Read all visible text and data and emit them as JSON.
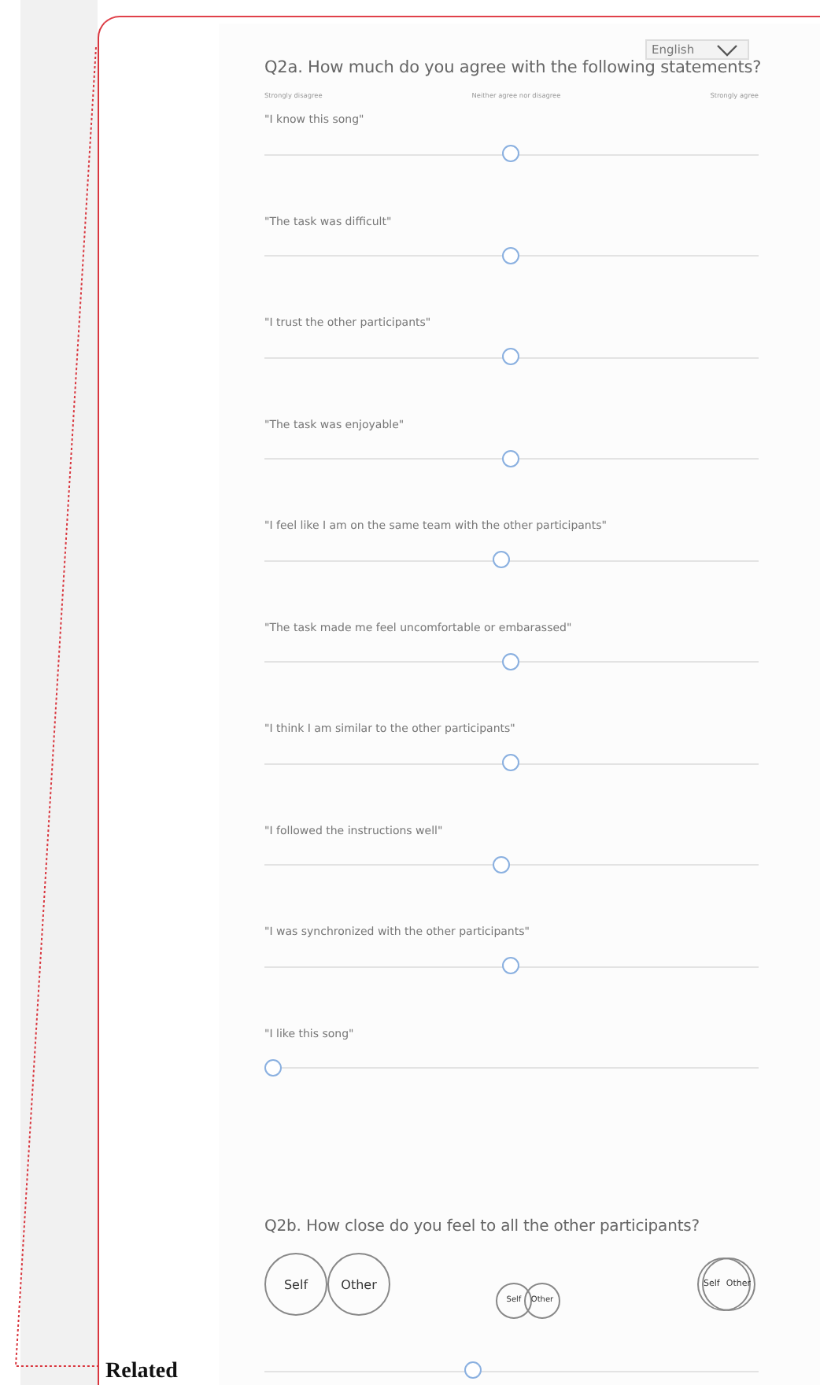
{
  "language_select": {
    "value": "English"
  },
  "q2a": {
    "title": "Q2a. How much do you agree with the following statements?",
    "scale_labels": [
      "Strongly disagree",
      "Neither agree nor disagree",
      "Strongly agree"
    ],
    "items": [
      {
        "statement": "\"I know this song\"",
        "level": 0.5
      },
      {
        "statement": "\"The task was difficult\"",
        "level": 0.5
      },
      {
        "statement": "\"I trust the other participants\"",
        "level": 0.5
      },
      {
        "statement": "\"The task was enjoyable\"",
        "level": 0.5
      },
      {
        "statement": "\"I feel like I am on the same team with the other participants\"",
        "level": 0.48
      },
      {
        "statement": "\"The task made me feel uncomfortable or embarassed\"",
        "level": 0.5
      },
      {
        "statement": "\"I think I am similar to the other participants\"",
        "level": 0.5
      },
      {
        "statement": "\"I followed the instructions well\"",
        "level": 0.48
      },
      {
        "statement": "\"I was synchronized with the other participants\"",
        "level": 0.5
      },
      {
        "statement": "\"I like this song\"",
        "level": 0
      }
    ]
  },
  "q2b": {
    "title": "Q2b. How close do you feel to all the other participants?",
    "options": [
      {
        "kind": "apart",
        "labels": [
          "Self",
          "Other"
        ]
      },
      {
        "kind": "overlap",
        "labels": [
          "Self",
          "Other"
        ]
      },
      {
        "kind": "merged",
        "labels": [
          "Self",
          "Other"
        ]
      }
    ],
    "level": 0.42
  },
  "footer_heading": "Related"
}
